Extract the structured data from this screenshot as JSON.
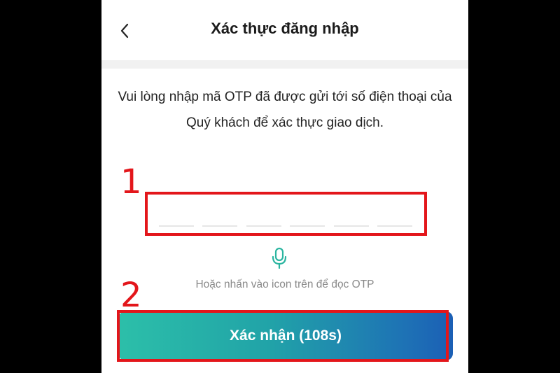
{
  "header": {
    "title": "Xác thực đăng nhập",
    "back_icon": "chevron-left-icon"
  },
  "instruction": "Vui lòng nhập mã OTP đã được gửi tới số điện thoại của Quý khách để xác thực giao dịch.",
  "otp": {
    "slots": 6,
    "value": ""
  },
  "voice": {
    "icon": "microphone-icon",
    "hint": "Hoặc nhấn vào icon trên để đọc OTP",
    "color": "#2bb5a0"
  },
  "confirm_button": {
    "label": "Xác nhận (108s)",
    "gradient_start": "#2cbfa9",
    "gradient_end": "#1b5fb5"
  },
  "annotations": {
    "step1": "1",
    "step2": "2",
    "color": "#e3161b"
  }
}
